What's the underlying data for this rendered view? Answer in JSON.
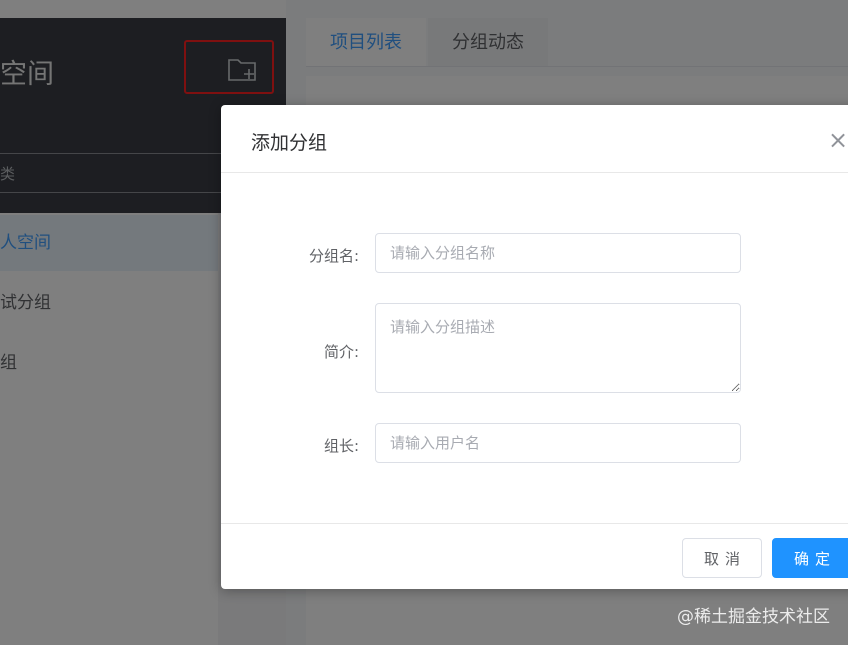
{
  "sidebar": {
    "title": "空间",
    "search_placeholder": "类",
    "items": [
      {
        "label": "人空间",
        "active": true
      },
      {
        "label": "试分组",
        "active": false
      },
      {
        "label": "组",
        "active": false
      }
    ],
    "new_folder_icon": "folder-plus-icon"
  },
  "tabs": [
    {
      "label": "项目列表",
      "active": true
    },
    {
      "label": "分组动态",
      "active": false
    }
  ],
  "dialog": {
    "title": "添加分组",
    "close_icon": "×",
    "fields": {
      "name": {
        "label": "分组名:",
        "placeholder": "请输入分组名称",
        "value": ""
      },
      "intro": {
        "label": "简介:",
        "placeholder": "请输入分组描述",
        "value": ""
      },
      "leader": {
        "label": "组长:",
        "placeholder": "请输入用户名",
        "value": ""
      }
    },
    "buttons": {
      "cancel": "取消",
      "ok": "确定"
    }
  },
  "watermark": "@稀土掘金技术社区",
  "colors": {
    "primary": "#1f93ff",
    "highlight": "#ff2020",
    "sidebar_dark": "#3a3d44"
  }
}
